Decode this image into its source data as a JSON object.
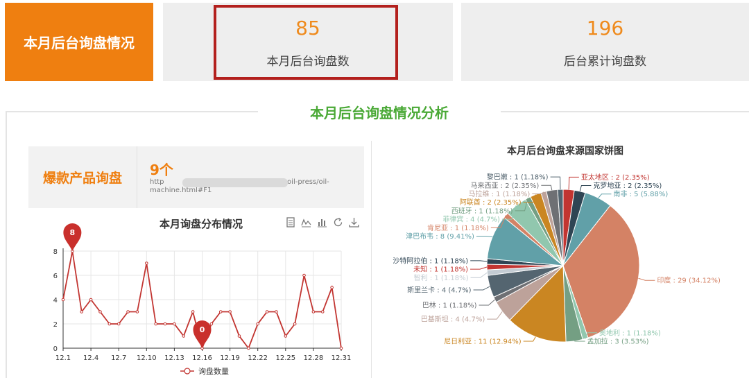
{
  "header": {
    "title": "本月后台询盘情况",
    "stats": [
      {
        "value": "85",
        "label": "本月后台询盘数"
      },
      {
        "value": "196",
        "label": "后台累计询盘数"
      }
    ]
  },
  "section": {
    "title": "本月后台询盘情况分析"
  },
  "hot_products": {
    "label": "爆款产品询盘",
    "count": "9个",
    "url_line1_prefix": "http",
    "url_line1_suffix": "crew-oil-press/oil-",
    "url_line2": "machine.html#F1"
  },
  "toolbox": {
    "data_view_icon": "data-view-icon",
    "line_icon": "line-chart-icon",
    "bar_icon": "bar-chart-icon",
    "restore_icon": "refresh-icon",
    "save_icon": "download-icon"
  },
  "colors": {
    "accent": "#ef7f10",
    "title_green": "#4aa936",
    "line_red": "#c23531",
    "highlight": "#b3201d"
  },
  "chart_data": [
    {
      "type": "line",
      "title": "本月询盘分布情况",
      "legend": "询盘数量",
      "legend_position": "bottom",
      "x": [
        "12.1",
        "12.2",
        "12.3",
        "12.4",
        "12.5",
        "12.6",
        "12.7",
        "12.8",
        "12.9",
        "12.10",
        "12.11",
        "12.12",
        "12.13",
        "12.14",
        "12.15",
        "12.16",
        "12.17",
        "12.18",
        "12.19",
        "12.20",
        "12.21",
        "12.22",
        "12.23",
        "12.24",
        "12.25",
        "12.26",
        "12.27",
        "12.28",
        "12.29",
        "12.30",
        "12.31"
      ],
      "x_ticks": [
        "12.1",
        "12.4",
        "12.7",
        "12.10",
        "12.13",
        "12.16",
        "12.19",
        "12.22",
        "12.25",
        "12.28",
        "12.31"
      ],
      "values": [
        4,
        8,
        3,
        4,
        3,
        2,
        2,
        3,
        3,
        7,
        2,
        2,
        2,
        1,
        3,
        0,
        2,
        3,
        3,
        1,
        0,
        2,
        3,
        3,
        1,
        2,
        6,
        3,
        3,
        5,
        0
      ],
      "ylim": [
        0,
        8
      ],
      "y_ticks": [
        0,
        2,
        4,
        6,
        8
      ],
      "markers": [
        {
          "label": "8",
          "index": 1
        },
        {
          "label": "0",
          "index": 15
        }
      ],
      "grid": true
    },
    {
      "type": "pie",
      "title": "本月后台询盘来源国家饼图",
      "slices": [
        {
          "label": "亚太地区 : 2 (2.35%)",
          "value": 2,
          "color": "#c23531",
          "side": "right"
        },
        {
          "label": "克罗地亚 : 2 (2.35%)",
          "value": 2,
          "color": "#2f4554",
          "side": "right"
        },
        {
          "label": "南非 : 5 (5.88%)",
          "value": 5,
          "color": "#61a0a8",
          "side": "right"
        },
        {
          "label": "印度 : 29 (34.12%)",
          "value": 29,
          "color": "#d48265",
          "side": "right"
        },
        {
          "label": "奥地利 : 1 (1.18%)",
          "value": 1,
          "color": "#91c7ae",
          "side": "right"
        },
        {
          "label": "孟加拉 : 3 (3.53%)",
          "value": 3,
          "color": "#749f83",
          "side": "right"
        },
        {
          "label": "尼日利亚 : 11 (12.94%)",
          "value": 11,
          "color": "#ca8622",
          "side": "left"
        },
        {
          "label": "巴基斯坦 : 4 (4.7%)",
          "value": 4,
          "color": "#bda29a",
          "side": "left"
        },
        {
          "label": "巴林 : 1 (1.18%)",
          "value": 1,
          "color": "#6e7074",
          "side": "left"
        },
        {
          "label": "斯里兰卡 : 4 (4.7%)",
          "value": 4,
          "color": "#546570",
          "side": "left"
        },
        {
          "label": "智利 : 1 (1.18%)",
          "value": 1,
          "color": "#c4ccd3",
          "side": "left"
        },
        {
          "label": "未知 : 1 (1.18%)",
          "value": 1,
          "color": "#c23531",
          "side": "left"
        },
        {
          "label": "沙特阿拉伯 : 1 (1.18%)",
          "value": 1,
          "color": "#2f4554",
          "side": "left"
        },
        {
          "label": "津巴布韦 : 8 (9.41%)",
          "value": 8,
          "color": "#61a0a8",
          "side": "left"
        },
        {
          "label": "肯尼亚 : 1 (1.18%)",
          "value": 1,
          "color": "#d48265",
          "side": "left"
        },
        {
          "label": "菲律宾 : 4 (4.7%)",
          "value": 4,
          "color": "#91c7ae",
          "side": "left"
        },
        {
          "label": "西班牙 : 1 (1.18%)",
          "value": 1,
          "color": "#749f83",
          "side": "left"
        },
        {
          "label": "阿联酋 : 2 (2.35%)",
          "value": 2,
          "color": "#ca8622",
          "side": "left"
        },
        {
          "label": "马拉维 : 1 (1.18%)",
          "value": 1,
          "color": "#bda29a",
          "side": "left"
        },
        {
          "label": "马来西亚 : 2 (2.35%)",
          "value": 2,
          "color": "#6e7074",
          "side": "left"
        },
        {
          "label": "黎巴嫩 : 1 (1.18%)",
          "value": 1,
          "color": "#546570",
          "side": "left"
        }
      ]
    }
  ]
}
